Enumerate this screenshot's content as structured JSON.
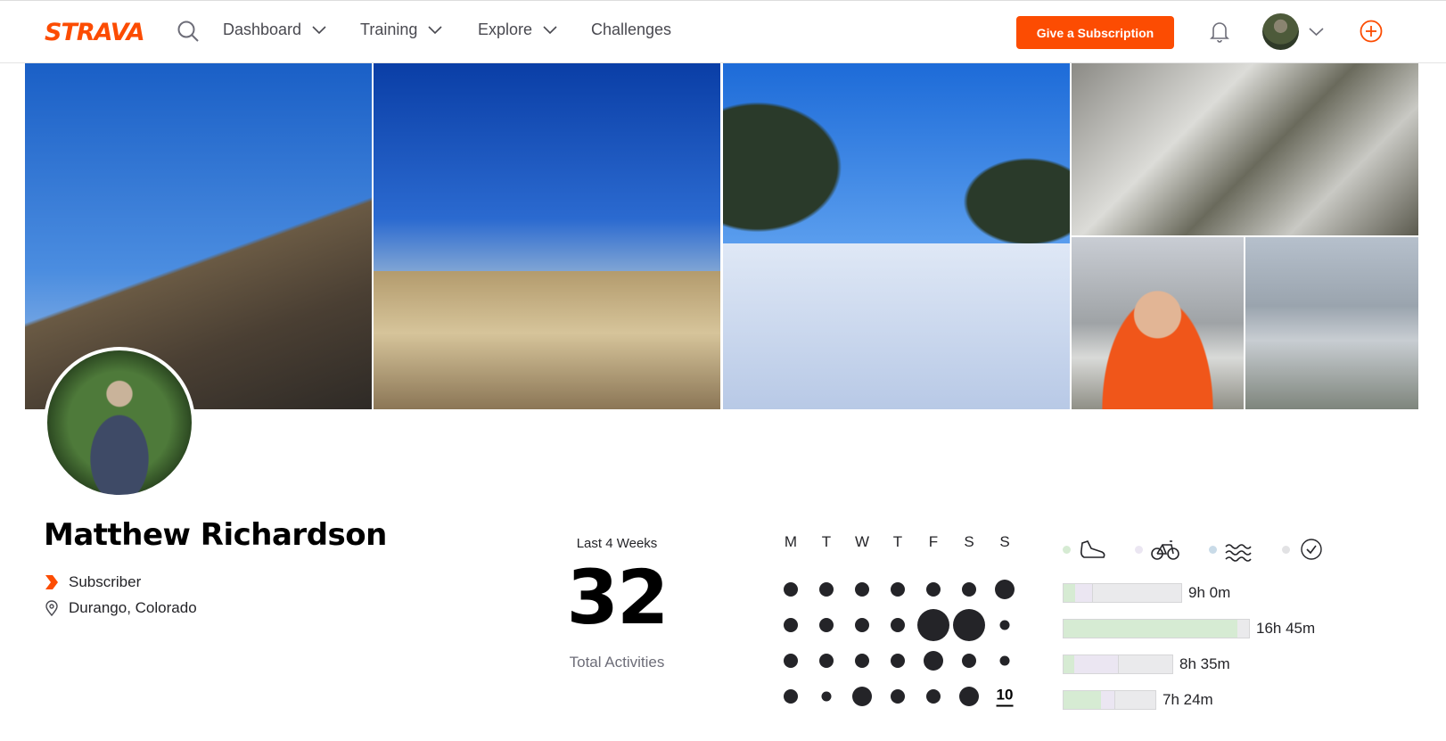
{
  "nav": {
    "logo": "STRAVA",
    "items": [
      {
        "label": "Dashboard",
        "has_dropdown": true
      },
      {
        "label": "Training",
        "has_dropdown": true
      },
      {
        "label": "Explore",
        "has_dropdown": true
      },
      {
        "label": "Challenges",
        "has_dropdown": false
      }
    ],
    "subscription_button": "Give a Subscription",
    "icons": [
      "search-icon",
      "bell-icon",
      "avatar",
      "chevron-down-icon",
      "plus-circle-icon"
    ]
  },
  "colors": {
    "brand": "#fc4c02",
    "run_bar": "#d6ebd3",
    "ride_bar": "#ebe6f2",
    "text": "#242428"
  },
  "profile": {
    "name": "Matthew Richardson",
    "badge": "Subscriber",
    "location": "Durango, Colorado"
  },
  "stats": {
    "period_label": "Last 4 Weeks",
    "total_activities": "32",
    "total_label": "Total Activities"
  },
  "calendar": {
    "day_headers": [
      "M",
      "T",
      "W",
      "T",
      "F",
      "S",
      "S"
    ],
    "today_label": "10",
    "weeks": [
      [
        "md",
        "md",
        "md",
        "md",
        "md",
        "md",
        "lg"
      ],
      [
        "md",
        "md",
        "md",
        "md",
        "xl",
        "xl",
        "sm"
      ],
      [
        "md",
        "md",
        "md",
        "md",
        "lg",
        "md",
        "sm"
      ],
      [
        "md",
        "sm",
        "lg",
        "md",
        "md",
        "lg",
        "today"
      ]
    ]
  },
  "sports": {
    "icons": [
      "run-shoe-icon",
      "bike-icon",
      "swim-icon",
      "check-circle-icon"
    ],
    "weekly_bars": [
      {
        "label": "9h 0m",
        "fill_fraction": 0.64
      },
      {
        "label": "16h 45m",
        "fill_fraction": 1.0
      },
      {
        "label": "8h 35m",
        "fill_fraction": 0.59
      },
      {
        "label": "7h 24m",
        "fill_fraction": 0.5
      }
    ]
  }
}
